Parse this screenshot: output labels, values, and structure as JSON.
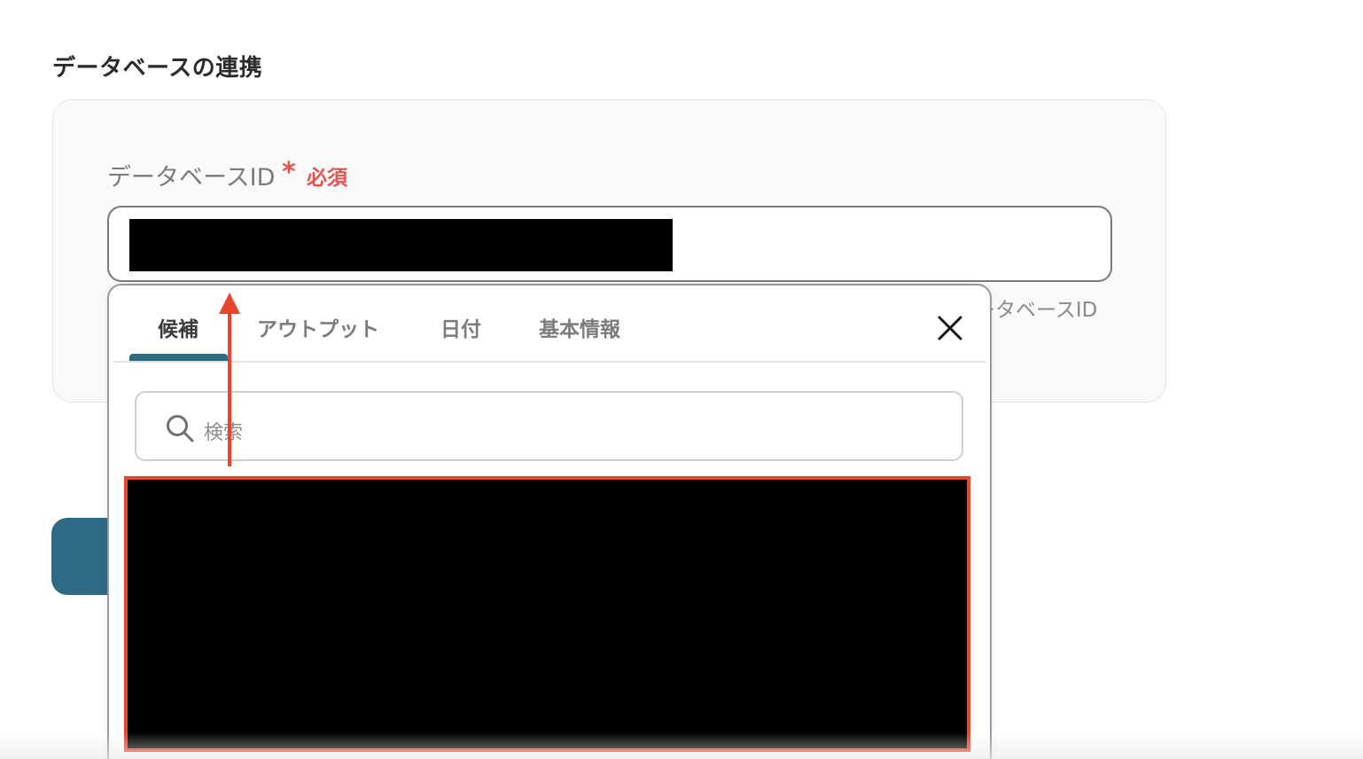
{
  "section": {
    "title": "データベースの連携"
  },
  "field": {
    "label": "データベースID",
    "required_mark": "*",
    "required_text": "必須",
    "value": "",
    "hint_partial": "ータベースID"
  },
  "popup": {
    "tabs": [
      {
        "label": "候補",
        "active": true
      },
      {
        "label": "アウトプット",
        "active": false
      },
      {
        "label": "日付",
        "active": false
      },
      {
        "label": "基本情報",
        "active": false
      }
    ],
    "close_icon": "close-icon",
    "search": {
      "placeholder": "検索",
      "icon": "search-icon"
    }
  },
  "colors": {
    "accent": "#2f6a85",
    "required": "#e0564f",
    "annotation": "#e7462d"
  }
}
